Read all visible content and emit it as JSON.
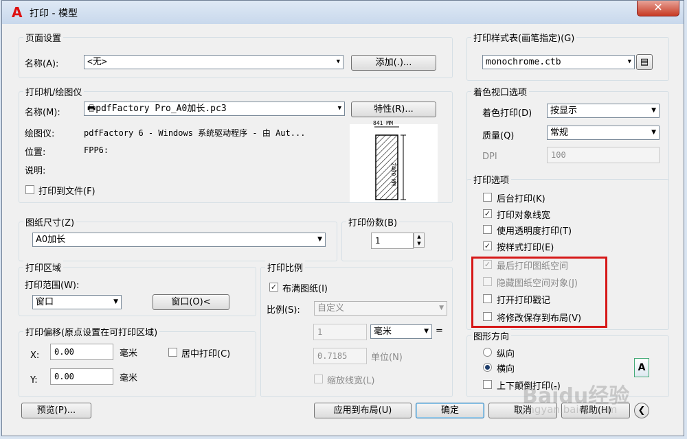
{
  "window": {
    "title": "打印 - 模型",
    "app_icon": "A",
    "close_label": "✕"
  },
  "page_setup": {
    "title": "页面设置",
    "name_label": "名称(A):",
    "name_value": "<无>",
    "add_button": "添加(.)..."
  },
  "printer": {
    "title": "打印机/绘图仪",
    "name_label": "名称(M):",
    "name_value": "pdfFactory Pro_A0加长.pc3",
    "properties_button": "特性(R)...",
    "plotter_label": "绘图仪:",
    "plotter_value": "pdfFactory 6 - Windows 系统驱动程序 - 由 Aut...",
    "location_label": "位置:",
    "location_value": "FPP6:",
    "description_label": "说明:",
    "print_to_file_label": "打印到文件(F)",
    "print_to_file_checked": false,
    "preview_width_label": "841 MM",
    "preview_height_label": "2400 MM"
  },
  "paper_size": {
    "title": "图纸尺寸(Z)",
    "value": "A0加长"
  },
  "copies": {
    "title": "打印份数(B)",
    "value": "1"
  },
  "plot_area": {
    "title": "打印区域",
    "range_label": "打印范围(W):",
    "range_value": "窗口",
    "window_button": "窗口(O)<"
  },
  "plot_offset": {
    "title": "打印偏移(原点设置在可打印区域)",
    "x_label": "X:",
    "x_value": "0.00",
    "x_unit": "毫米",
    "y_label": "Y:",
    "y_value": "0.00",
    "y_unit": "毫米",
    "center_label": "居中打印(C)",
    "center_checked": false
  },
  "plot_scale": {
    "title": "打印比例",
    "fit_label": "布满图纸(I)",
    "fit_checked": true,
    "scale_label": "比例(S):",
    "scale_value": "自定义",
    "value1": "1",
    "unit1": "毫米",
    "equals": "=",
    "value2": "0.7185",
    "unit2": "单位(N)",
    "scale_lineweights_label": "缩放线宽(L)",
    "scale_lineweights_checked": false
  },
  "plot_style_table": {
    "title": "打印样式表(画笔指定)(G)",
    "value": "monochrome.ctb",
    "edit_icon_label": "▤"
  },
  "shaded_viewport": {
    "title": "着色视口选项",
    "shade_plot_label": "着色打印(D)",
    "shade_plot_value": "按显示",
    "quality_label": "质量(Q)",
    "quality_value": "常规",
    "dpi_label": "DPI",
    "dpi_value": "100"
  },
  "plot_options": {
    "title": "打印选项",
    "items": [
      {
        "label": "后台打印(K)",
        "checked": false,
        "enabled": true
      },
      {
        "label": "打印对象线宽",
        "checked": true,
        "enabled": true
      },
      {
        "label": "使用透明度打印(T)",
        "checked": false,
        "enabled": true
      },
      {
        "label": "按样式打印(E)",
        "checked": true,
        "enabled": true
      },
      {
        "label": "最后打印图纸空间",
        "checked": true,
        "enabled": false
      },
      {
        "label": "隐藏图纸空间对象(J)",
        "checked": false,
        "enabled": false
      },
      {
        "label": "打开打印戳记",
        "checked": false,
        "enabled": true
      },
      {
        "label": "将修改保存到布局(V)",
        "checked": false,
        "enabled": true
      }
    ]
  },
  "orientation": {
    "title": "图形方向",
    "portrait_label": "纵向",
    "landscape_label": "横向",
    "selected": "landscape",
    "upside_down_label": "上下颠倒打印(-)",
    "upside_down_checked": false,
    "icon_label": "A"
  },
  "footer": {
    "preview_button": "预览(P)...",
    "apply_button": "应用到布局(U)",
    "ok_button": "确定",
    "cancel_button": "取消",
    "help_button": "帮助(H)",
    "more_icon": "❮"
  },
  "watermark": {
    "text": "Baidu经验",
    "url": "jingyan.baidu.com"
  },
  "colors": {
    "highlight": "#d61818",
    "title_bar": "#c8d8ec",
    "dialog_bg": "#f0f0f0"
  }
}
